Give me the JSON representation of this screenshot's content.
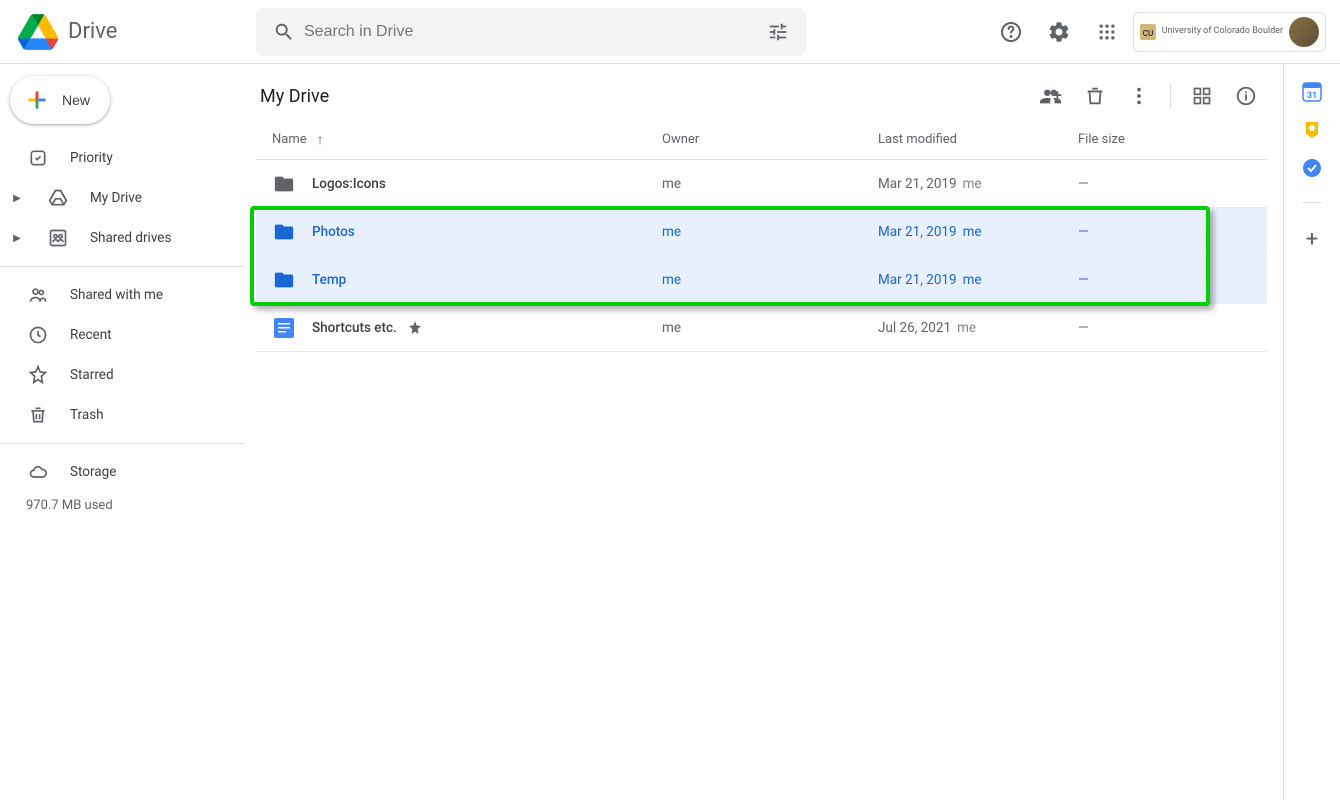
{
  "app": {
    "title": "Drive"
  },
  "search": {
    "placeholder": "Search in Drive"
  },
  "account": {
    "org": "University of Colorado Boulder"
  },
  "sidebar": {
    "new_label": "New",
    "items": [
      {
        "label": "Priority"
      },
      {
        "label": "My Drive"
      },
      {
        "label": "Shared drives"
      },
      {
        "label": "Shared with me"
      },
      {
        "label": "Recent"
      },
      {
        "label": "Starred"
      },
      {
        "label": "Trash"
      },
      {
        "label": "Storage"
      }
    ],
    "storage_used": "970.7 MB used"
  },
  "content": {
    "title": "My Drive",
    "columns": {
      "name": "Name",
      "owner": "Owner",
      "modified": "Last modified",
      "size": "File size"
    },
    "rows": [
      {
        "name": "Logos:Icons",
        "owner": "me",
        "modified": "Mar 21, 2019",
        "modified_by": "me",
        "size": "—",
        "type": "folder",
        "selected": false,
        "starred": false
      },
      {
        "name": "Photos",
        "owner": "me",
        "modified": "Mar 21, 2019",
        "modified_by": "me",
        "size": "—",
        "type": "folder",
        "selected": true,
        "starred": false
      },
      {
        "name": "Temp",
        "owner": "me",
        "modified": "Mar 21, 2019",
        "modified_by": "me",
        "size": "—",
        "type": "folder",
        "selected": true,
        "starred": false
      },
      {
        "name": "Shortcuts etc.",
        "owner": "me",
        "modified": "Jul 26, 2021",
        "modified_by": "me",
        "size": "—",
        "type": "doc",
        "selected": false,
        "starred": true
      }
    ]
  }
}
